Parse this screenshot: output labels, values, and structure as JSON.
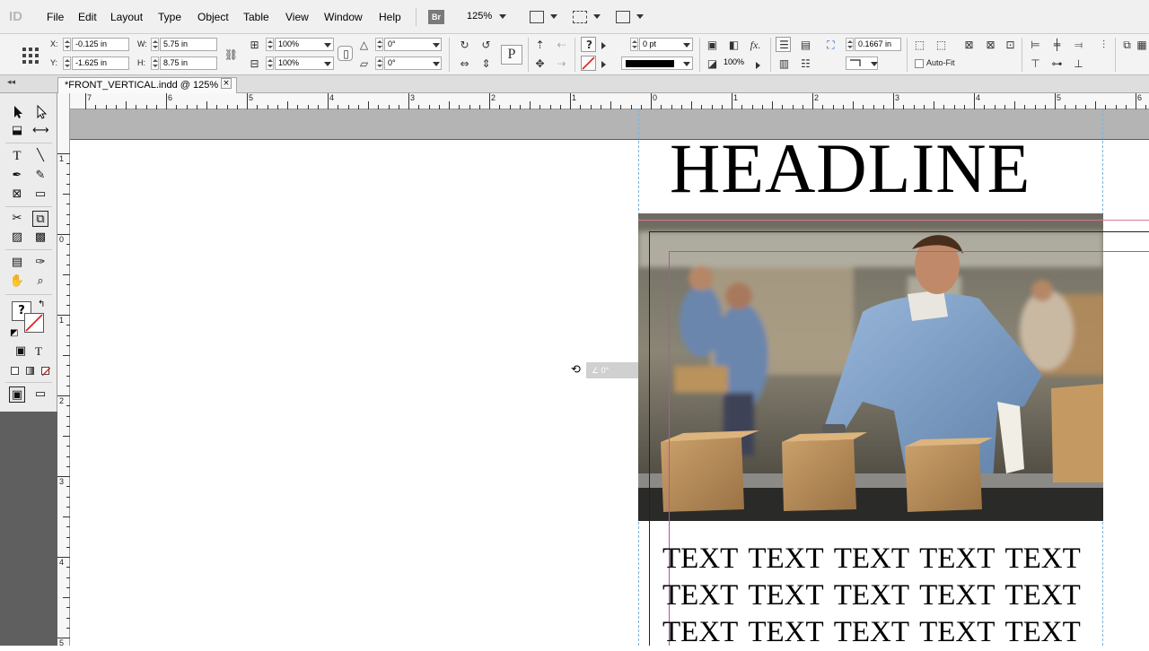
{
  "app": {
    "logo": "ID"
  },
  "menu": [
    "File",
    "Edit",
    "Layout",
    "Type",
    "Object",
    "Table",
    "View",
    "Window",
    "Help"
  ],
  "toolbar": {
    "bridge_label": "Br",
    "zoom": "125%"
  },
  "control": {
    "x_label": "X:",
    "x_value": "-0.125 in",
    "y_label": "Y:",
    "y_value": "-1.625 in",
    "w_label": "W:",
    "w_value": "5.75 in",
    "h_label": "H:",
    "h_value": "8.75 in",
    "scale_x": "100%",
    "scale_y": "100%",
    "rotate": "0°",
    "shear": "0°",
    "stroke_weight": "0 pt",
    "opacity": "100%",
    "offset": "0.1667 in",
    "autofit_label": "Auto-Fit"
  },
  "document": {
    "tab_title": "*FRONT_VERTICAL.indd @ 125%",
    "close": "×"
  },
  "hruler": [
    "7",
    "6",
    "5",
    "4",
    "3",
    "2",
    "1",
    "0",
    "1",
    "2",
    "3",
    "4",
    "5",
    "6"
  ],
  "vruler": [
    "1",
    "0",
    "1",
    "2",
    "3",
    "4",
    "5"
  ],
  "canvas": {
    "headline": "HEADLINE",
    "body_lines": [
      "TEXT TEXT TEXT TEXT TEXT",
      "TEXT TEXT TEXT TEXT TEXT",
      "TEXT TEXT TEXT TEXT TEXT"
    ],
    "angle_tip": "∠ 0°"
  },
  "colors": {
    "pasteboard_band": "#b4b4b4",
    "frame_magenta": "#d04fb3",
    "guide_blue": "#7eb3d8",
    "tools_dark": "#5f5f5f"
  },
  "icons": [
    "select-icon",
    "direct-select-icon",
    "type-icon",
    "line-icon",
    "pen-icon",
    "pencil-icon",
    "rectangle-frame-icon",
    "rectangle-icon",
    "scissors-icon",
    "free-transform-icon",
    "gradient-icon",
    "gradient-feather-icon",
    "note-icon",
    "eyedropper-icon",
    "hand-icon",
    "zoom-icon"
  ]
}
